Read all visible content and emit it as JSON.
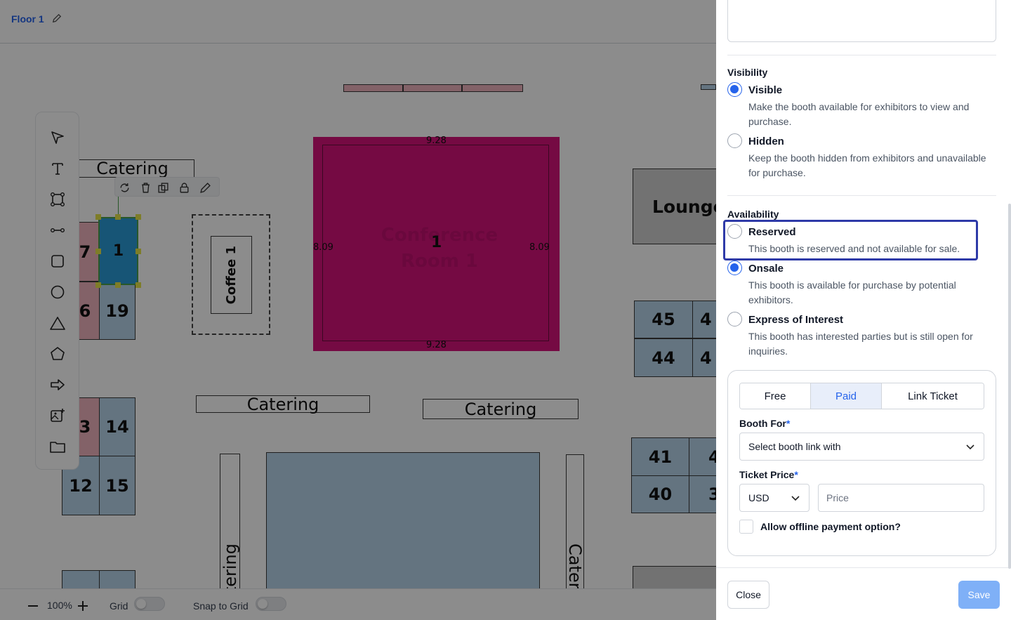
{
  "header": {
    "floor_title": "Floor 1"
  },
  "floorplan": {
    "catering_labels": [
      "Catering",
      "Catering",
      "Catering",
      "tering",
      "Cateri"
    ],
    "lounge_label": "Lounge",
    "coffee_label": "Coffee 1",
    "conference_label": "Conference Room 1",
    "conference_number": "1",
    "conference_dims": {
      "top": "9.28",
      "bottom": "9.28",
      "left": "8.09",
      "right": "8.09"
    },
    "selected_booth_number": "1",
    "booths": [
      "7",
      "6",
      "19",
      "3",
      "14",
      "12",
      "15",
      "45",
      "44",
      "41",
      "40",
      "4",
      "4",
      "4",
      "3"
    ]
  },
  "bottom_bar": {
    "zoom": "100%",
    "grid_label": "Grid",
    "snap_label": "Snap to Grid"
  },
  "panel": {
    "visibility": {
      "title": "Visibility",
      "options": [
        {
          "label": "Visible",
          "desc": "Make the booth available for exhibitors to view and purchase.",
          "selected": true
        },
        {
          "label": "Hidden",
          "desc": "Keep the booth hidden from exhibitors and unavailable for purchase.",
          "selected": false
        }
      ]
    },
    "availability": {
      "title": "Availability",
      "options": [
        {
          "label": "Reserved",
          "desc": "This booth is reserved and not available for sale.",
          "selected": false
        },
        {
          "label": "Onsale",
          "desc": "This booth is available for purchase by potential exhibitors.",
          "selected": true
        },
        {
          "label": "Express of Interest",
          "desc": "This booth has interested parties but is still open for inquiries.",
          "selected": false
        }
      ]
    },
    "pricing": {
      "tabs": [
        "Free",
        "Paid",
        "Link Ticket"
      ],
      "active_tab": "Paid",
      "booth_for_label": "Booth For",
      "booth_for_value": "Select booth link with",
      "ticket_price_label": "Ticket Price",
      "currency": "USD",
      "price_placeholder": "Price",
      "offline_label": "Allow offline payment option?",
      "required_mark": "*"
    },
    "footer": {
      "close_label": "Close",
      "save_label": "Save"
    },
    "accent_color": "#2563eb"
  }
}
